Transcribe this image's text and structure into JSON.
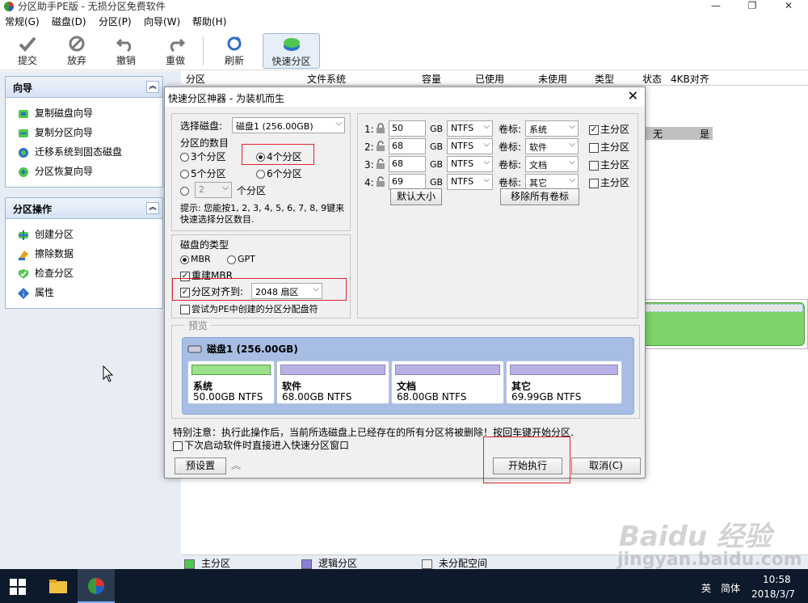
{
  "window": {
    "title": "分区助手PE版 - 无损分区免费软件"
  },
  "menu": [
    "常规(G)",
    "磁盘(D)",
    "分区(P)",
    "向导(W)",
    "帮助(H)"
  ],
  "toolbar": {
    "commit": "提交",
    "discard": "放弃",
    "undo": "撤销",
    "redo": "重做",
    "refresh": "刷新",
    "quick_partition": "快速分区"
  },
  "wizard_panel": {
    "title": "向导",
    "items": [
      "复制磁盘向导",
      "复制分区向导",
      "迁移系统到固态磁盘",
      "分区恢复向导"
    ]
  },
  "partition_ops_panel": {
    "title": "分区操作",
    "items": [
      "创建分区",
      "擦除数据",
      "检查分区",
      "属性"
    ]
  },
  "table": {
    "columns": [
      "分区",
      "文件系统",
      "容量",
      "已使用",
      "未使用",
      "类型",
      "状态",
      "4KB对齐"
    ],
    "visible_row": {
      "status": "无",
      "aligned": "是"
    }
  },
  "status_legend": {
    "primary": "主分区",
    "logical": "逻辑分区",
    "unallocated": "未分配空间"
  },
  "colors": {
    "primary": "#4ec84e",
    "logical": "#8c7fd8",
    "unallocated": "#f0f0f0",
    "accent": "#e0242a"
  },
  "dialog": {
    "title": "快速分区神器 - 为装机而生",
    "select_disk_label": "选择磁盘:",
    "select_disk_value": "磁盘1 (256.00GB)",
    "partition_count_label": "分区的数目",
    "count_options": [
      "3个分区",
      "4个分区",
      "5个分区",
      "6个分区"
    ],
    "count_selected": "4个分区",
    "custom_count_value": "2",
    "custom_count_suffix": "个分区",
    "hint": "提示: 您能按1, 2, 3, 4, 5, 6, 7, 8, 9键来快速选择分区数目.",
    "disk_type_label": "磁盘的类型",
    "disk_types": [
      "MBR",
      "GPT"
    ],
    "disk_type_selected": "MBR",
    "rebuild_mbr": "重建MBR",
    "align_label": "分区对齐到:",
    "align_value": "2048 扇区",
    "try_letter": "尝试为PE中创建的分区分配盘符",
    "partitions": [
      {
        "idx": "1:",
        "size": "50",
        "unit": "GB",
        "fs": "NTFS",
        "label_text": "卷标:",
        "label": "系统",
        "primary_text": "主分区",
        "primary": true
      },
      {
        "idx": "2:",
        "size": "68",
        "unit": "GB",
        "fs": "NTFS",
        "label_text": "卷标:",
        "label": "软件",
        "primary_text": "主分区",
        "primary": false
      },
      {
        "idx": "3:",
        "size": "68",
        "unit": "GB",
        "fs": "NTFS",
        "label_text": "卷标:",
        "label": "文档",
        "primary_text": "主分区",
        "primary": false
      },
      {
        "idx": "4:",
        "size": "69",
        "unit": "GB",
        "fs": "NTFS",
        "label_text": "卷标:",
        "label": "其它",
        "primary_text": "主分区",
        "primary": false
      }
    ],
    "default_size_button": "默认大小",
    "remove_labels_button": "移除所有卷标",
    "preview_label": "预览",
    "preview_disk": "磁盘1 (256.00GB)",
    "preview_parts": [
      {
        "name": "系统",
        "size": "50.00GB NTFS"
      },
      {
        "name": "软件",
        "size": "68.00GB NTFS"
      },
      {
        "name": "文档",
        "size": "68.00GB NTFS"
      },
      {
        "name": "其它",
        "size": "69.99GB NTFS"
      }
    ],
    "warning": "特别注意：执行此操作后，当前所选磁盘上已经存在的所有分区将被删除！按回车键开始分区.",
    "next_boot": "下次启动软件时直接进入快速分区窗口",
    "preset_button": "预设置",
    "start_button": "开始执行",
    "cancel_button": "取消(C)"
  },
  "taskbar": {
    "lang": "英",
    "ime": "简体",
    "time": "10:58",
    "date": "2018/3/7"
  },
  "watermark": {
    "brand": "Baidu 经验",
    "url": "jingyan.baidu.com"
  }
}
